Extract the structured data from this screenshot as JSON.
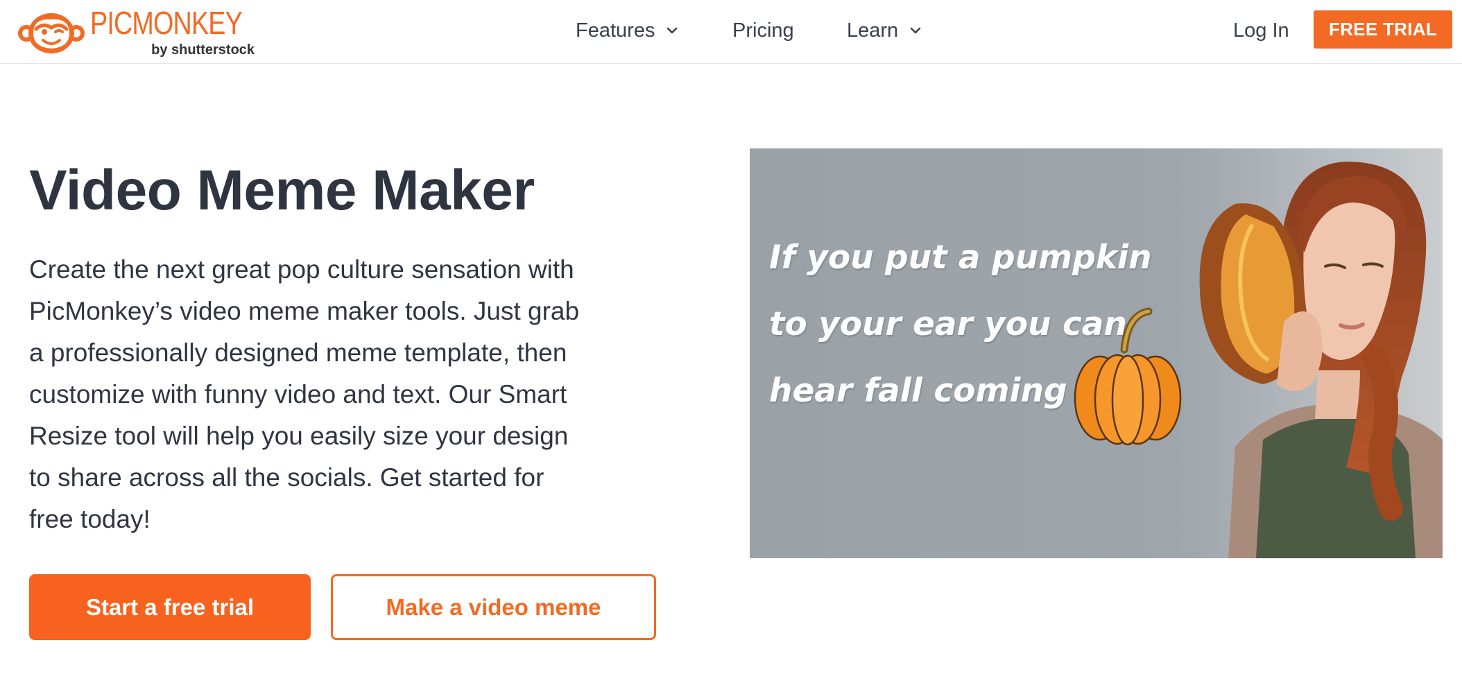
{
  "header": {
    "logo": {
      "name": "PICMONKEY",
      "sub": "by shutterstock"
    },
    "nav": [
      {
        "label": "Features",
        "has_dropdown": true
      },
      {
        "label": "Pricing",
        "has_dropdown": false
      },
      {
        "label": "Learn",
        "has_dropdown": true
      }
    ],
    "login_label": "Log In",
    "free_trial_label": "FREE TRIAL"
  },
  "hero": {
    "title": "Video Meme Maker",
    "description": "Create the next great pop culture sensation with PicMonkey’s video meme maker tools. Just grab a professionally designed meme template, then customize with funny video and text. Our Smart Resize tool will help you easily size your design to share across all the socials. Get started for free today!",
    "primary_cta": "Start a free trial",
    "secondary_cta": "Make a video meme"
  },
  "meme": {
    "caption": "If you put a pumpkin to your ear you can hear fall coming"
  },
  "colors": {
    "brand_orange": "#f26a23",
    "cta_orange": "#f7631e",
    "text_dark": "#2e3440",
    "meme_background": "#9aa1a7"
  },
  "icons": {
    "logo": "monkey-face-icon",
    "dropdown": "chevron-down-icon"
  }
}
